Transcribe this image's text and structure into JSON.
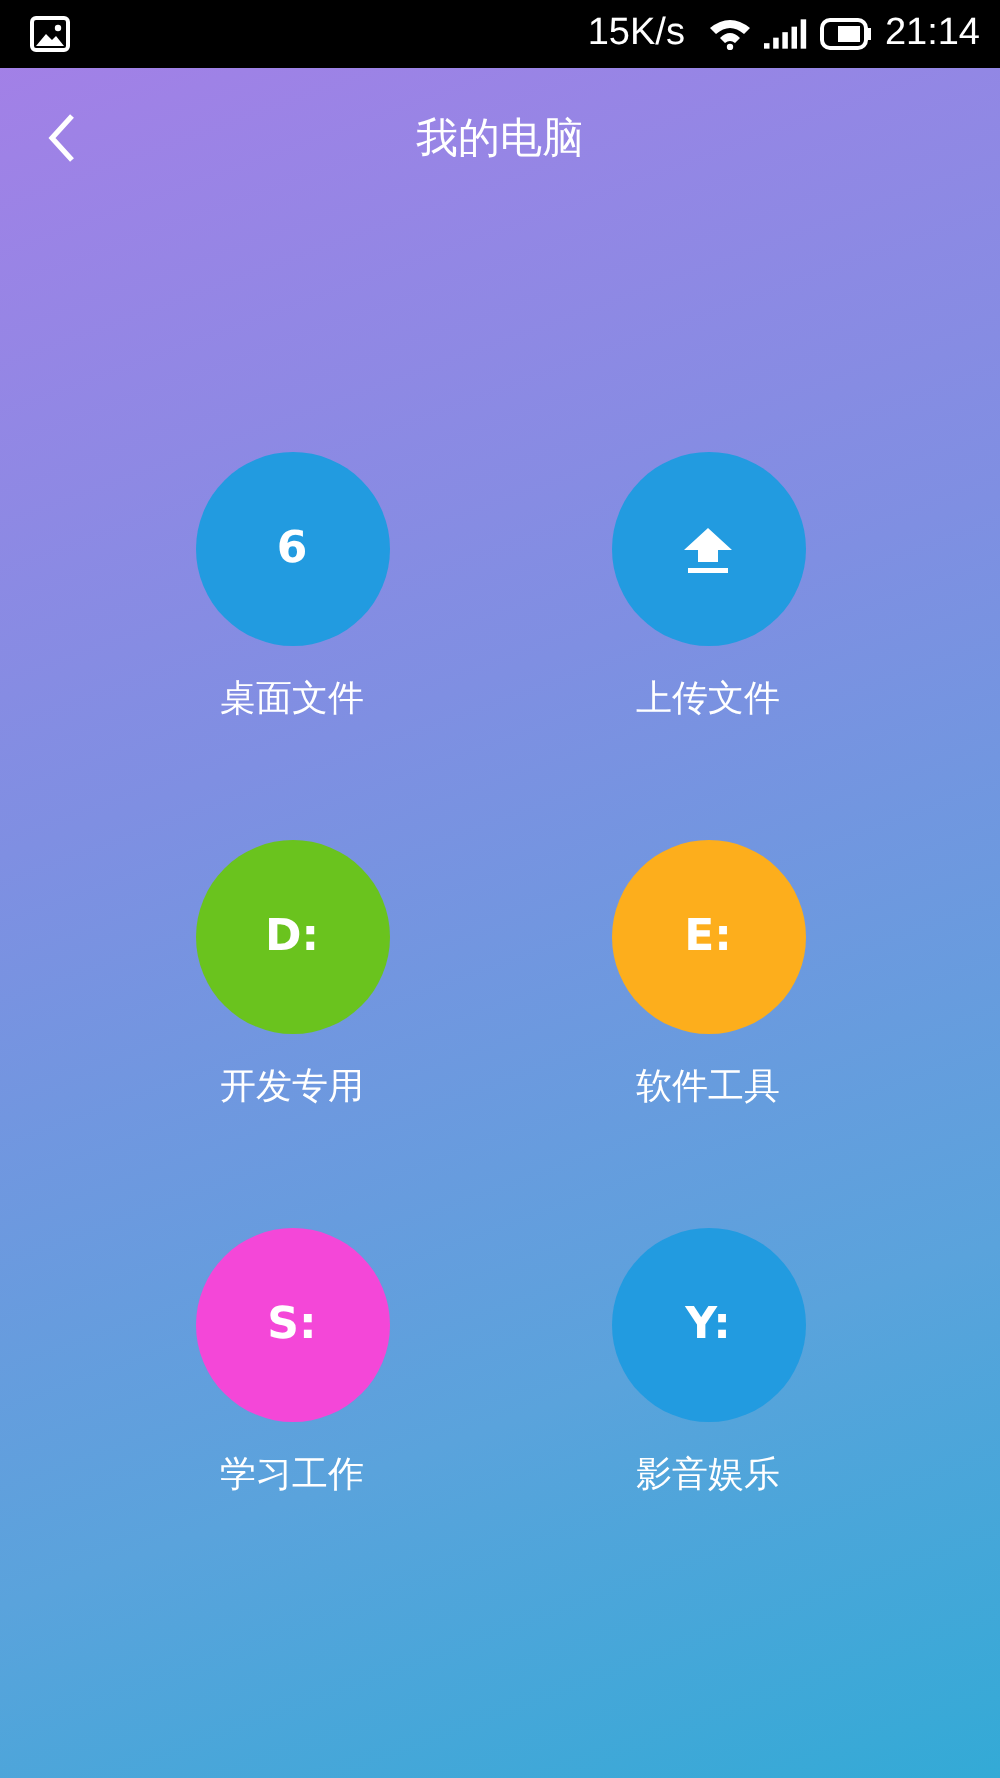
{
  "status_bar": {
    "speed": "15K/s",
    "time": "21:14"
  },
  "header": {
    "title": "我的电脑"
  },
  "tiles": [
    {
      "kind": "text",
      "badge": "6",
      "label": "桌面文件",
      "color": "#229be0"
    },
    {
      "kind": "upload",
      "label": "上传文件",
      "color": "#229be0"
    },
    {
      "kind": "text",
      "badge": "D:",
      "label": "开发专用",
      "color": "#6ac31e"
    },
    {
      "kind": "text",
      "badge": "E:",
      "label": "软件工具",
      "color": "#fdae1c"
    },
    {
      "kind": "text",
      "badge": "S:",
      "label": "学习工作",
      "color": "#f447d8"
    },
    {
      "kind": "text",
      "badge": "Y:",
      "label": "影音娱乐",
      "color": "#229be0"
    }
  ]
}
